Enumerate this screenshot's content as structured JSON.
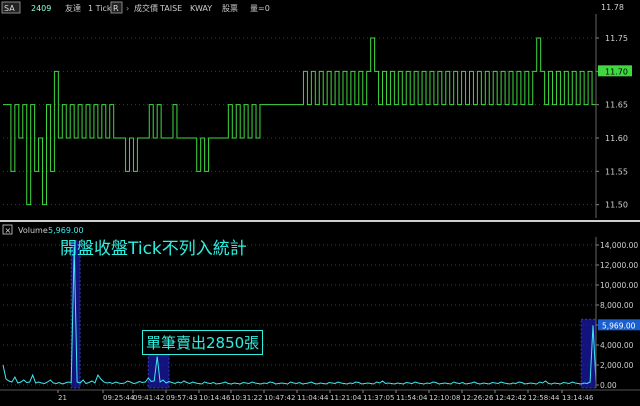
{
  "toolbar": {
    "sa_button": "SA",
    "symbol_code": "2409",
    "symbol_name": "友達",
    "interval": "1 Tick",
    "r_button": "R",
    "r_label": "成交價",
    "exchange": "TAISE",
    "source": "KWAY",
    "stock_label": "股票",
    "qty_label": "量=0"
  },
  "volume_panel": {
    "close_glyph": "×",
    "title": "Volume",
    "value": "5,969.00"
  },
  "annotations": {
    "open_close_note": "開盤收盤Tick不列入統計",
    "single_trade_note": "單筆賣出2850張"
  },
  "colors": {
    "background": "#000000",
    "price_line": "#3fd83f",
    "volume_line": "#40e8f0",
    "highlight_box": "#1a1aa8",
    "price_marker": "#3fd83f",
    "annotation_text": "#2ff0e0"
  },
  "chart_data": [
    {
      "type": "line",
      "title": "",
      "series": [
        {
          "name": "",
          "x": [
            0,
            2,
            4,
            6,
            8,
            10,
            12,
            14,
            16,
            18,
            20,
            22,
            24,
            26,
            28,
            30,
            32,
            34,
            36,
            38,
            40,
            42,
            44,
            46,
            48,
            50,
            52,
            54,
            56,
            58,
            60,
            62,
            64,
            66,
            68,
            70,
            72,
            74,
            76,
            78,
            80,
            82,
            84,
            86,
            88,
            90,
            92,
            94,
            96,
            98,
            100,
            102,
            104,
            106,
            108,
            110,
            112,
            114,
            116,
            118,
            120,
            122,
            124,
            126,
            128,
            130,
            132,
            134,
            136,
            138,
            140,
            142,
            144,
            146,
            148,
            150,
            152,
            154,
            156,
            158,
            160,
            162,
            164,
            166,
            168,
            170,
            172,
            174,
            176,
            178,
            180,
            182,
            184,
            186,
            188,
            190,
            192,
            194,
            196,
            198,
            200,
            202,
            204,
            206,
            208,
            210,
            212,
            214,
            216,
            218,
            220,
            222,
            224,
            226,
            228,
            230,
            232,
            234,
            236,
            238,
            240,
            242,
            244,
            246,
            248,
            250,
            252,
            254,
            256,
            258,
            260,
            262,
            264,
            266,
            268,
            270,
            272,
            274,
            276,
            278,
            280,
            282,
            284,
            286,
            288,
            290,
            292,
            294,
            296,
            298,
            300
          ],
          "values": [
            11.65,
            11.65,
            11.55,
            11.65,
            11.6,
            11.65,
            11.5,
            11.65,
            11.55,
            11.6,
            11.5,
            11.65,
            11.55,
            11.7,
            11.6,
            11.65,
            11.6,
            11.65,
            11.6,
            11.65,
            11.6,
            11.65,
            11.6,
            11.65,
            11.6,
            11.65,
            11.6,
            11.65,
            11.6,
            11.6,
            11.6,
            11.55,
            11.6,
            11.55,
            11.6,
            11.6,
            11.6,
            11.65,
            11.6,
            11.65,
            11.6,
            11.6,
            11.6,
            11.65,
            11.6,
            11.6,
            11.6,
            11.6,
            11.6,
            11.55,
            11.6,
            11.55,
            11.6,
            11.6,
            11.6,
            11.6,
            11.6,
            11.65,
            11.6,
            11.65,
            11.6,
            11.65,
            11.6,
            11.65,
            11.6,
            11.65,
            11.65,
            11.65,
            11.65,
            11.65,
            11.65,
            11.65,
            11.65,
            11.65,
            11.65,
            11.65,
            11.7,
            11.65,
            11.7,
            11.65,
            11.7,
            11.65,
            11.7,
            11.65,
            11.7,
            11.65,
            11.7,
            11.65,
            11.7,
            11.65,
            11.7,
            11.65,
            11.7,
            11.75,
            11.7,
            11.65,
            11.7,
            11.65,
            11.7,
            11.65,
            11.7,
            11.65,
            11.7,
            11.65,
            11.7,
            11.65,
            11.7,
            11.65,
            11.7,
            11.65,
            11.7,
            11.65,
            11.7,
            11.65,
            11.7,
            11.65,
            11.7,
            11.65,
            11.7,
            11.65,
            11.7,
            11.65,
            11.7,
            11.65,
            11.7,
            11.65,
            11.7,
            11.65,
            11.7,
            11.65,
            11.7,
            11.65,
            11.7,
            11.65,
            11.7,
            11.75,
            11.7,
            11.65,
            11.7,
            11.65,
            11.7,
            11.65,
            11.7,
            11.65,
            11.7,
            11.65,
            11.7,
            11.65,
            11.7,
            11.65,
            11.7
          ]
        }
      ],
      "ylim": [
        11.48,
        11.78
      ],
      "y_ticks": [
        "11.50",
        "11.55",
        "11.60",
        "11.65",
        "11.70",
        "11.75"
      ],
      "y_ticks_values": [
        11.5,
        11.55,
        11.6,
        11.65,
        11.7,
        11.75
      ],
      "last_value_label": "11.70",
      "last_value": 11.7,
      "top_value_label": "11.78"
    },
    {
      "type": "bar",
      "title": "Volume",
      "x": [
        0,
        1,
        2,
        3,
        4,
        5,
        6,
        7,
        8,
        9,
        10,
        11,
        12,
        13,
        14,
        15,
        16,
        17,
        18,
        19,
        20,
        21,
        22,
        23,
        24,
        25,
        26,
        27,
        28,
        29,
        30,
        31,
        32,
        33,
        34,
        35,
        36,
        37,
        38,
        39,
        40,
        41,
        42,
        43,
        44,
        45,
        46,
        47,
        48,
        49,
        50,
        51,
        52,
        53,
        54,
        55,
        56,
        57,
        58,
        59,
        60,
        61,
        62,
        63,
        64,
        65,
        66,
        67,
        68,
        69,
        70,
        71,
        72,
        73,
        74,
        75,
        76,
        77,
        78,
        79,
        80,
        81,
        82,
        83,
        84,
        85,
        86,
        87,
        88,
        89,
        90,
        91,
        92,
        93,
        94,
        95,
        96,
        97,
        98,
        99,
        100,
        101,
        102,
        103,
        104,
        105,
        106,
        107,
        108,
        109,
        110,
        111,
        112,
        113,
        114,
        115,
        116,
        117,
        118,
        119,
        120,
        121,
        122,
        123,
        124,
        125,
        126,
        127,
        128,
        129,
        130,
        131,
        132,
        133,
        134,
        135,
        136,
        137,
        138,
        139,
        140,
        141,
        142,
        143,
        144,
        145,
        146,
        147,
        148,
        149,
        150,
        151,
        152,
        153,
        154,
        155,
        156,
        157,
        158,
        159,
        160,
        161,
        162,
        163,
        164,
        165,
        166,
        167,
        168,
        169,
        170,
        171,
        172,
        173,
        174,
        175,
        176,
        177,
        178,
        179,
        180,
        181,
        182,
        183,
        184,
        185,
        186,
        187,
        188,
        189,
        190,
        191,
        192,
        193,
        194,
        195,
        196,
        197,
        198,
        199,
        200
      ],
      "values": [
        2000,
        600,
        400,
        300,
        800,
        200,
        300,
        500,
        250,
        300,
        1000,
        200,
        300,
        200,
        150,
        300,
        500,
        200,
        150,
        250,
        100,
        200,
        300,
        250,
        13800,
        300,
        200,
        500,
        150,
        250,
        400,
        200,
        1000,
        600,
        300,
        200,
        250,
        150,
        300,
        200,
        150,
        200,
        400,
        300,
        150,
        200,
        350,
        250,
        300,
        700,
        350,
        400,
        2850,
        300,
        500,
        200,
        350,
        250,
        150,
        300,
        200,
        400,
        250,
        150,
        300,
        200,
        150,
        100,
        300,
        200,
        150,
        250,
        100,
        150,
        200,
        300,
        150,
        100,
        200,
        150,
        100,
        250,
        200,
        150,
        300,
        200,
        150,
        100,
        200,
        150,
        300,
        250,
        100,
        150,
        200,
        150,
        100,
        300,
        200,
        150,
        250,
        100,
        150,
        200,
        300,
        150,
        100,
        200,
        150,
        100,
        250,
        200,
        150,
        300,
        200,
        150,
        100,
        200,
        150,
        300,
        250,
        100,
        150,
        200,
        150,
        100,
        300,
        200,
        400,
        150,
        200,
        150,
        100,
        200,
        150,
        100,
        250,
        200,
        150,
        300,
        200,
        150,
        100,
        200,
        150,
        300,
        250,
        100,
        150,
        200,
        150,
        100,
        300,
        200,
        150,
        250,
        100,
        150,
        200,
        300,
        150,
        100,
        200,
        150,
        100,
        250,
        200,
        150,
        300,
        200,
        150,
        100,
        200,
        150,
        300,
        250,
        100,
        150,
        200,
        150,
        100,
        300,
        200,
        400,
        150,
        100,
        200,
        150,
        100,
        250,
        200,
        150,
        300,
        200,
        150,
        100,
        200,
        150,
        300,
        5969,
        300,
        200,
        100
      ],
      "ylim": [
        -300,
        14800
      ],
      "y_ticks": [
        "0.00",
        "2,000.00",
        "4,000.00",
        "6,000.00",
        "8,000.00",
        "10,000.00",
        "12,000.00",
        "14,000.00"
      ],
      "y_ticks_values": [
        0,
        2000,
        4000,
        6000,
        8000,
        10000,
        12000,
        14000
      ],
      "last_value_label": "5,969.00",
      "last_value": 5969,
      "x_ticks": [
        "21",
        "09:25:44",
        "09:41:42",
        "09:57:43",
        "10:14:46",
        "10:31:22",
        "10:47:42",
        "11:04:44",
        "11:21:04",
        "11:37:05",
        "11:54:04",
        "12:10:08",
        "12:26:26",
        "12:42:42",
        "12:58:44",
        "13:14:46"
      ],
      "highlight_ranges": [
        [
          23,
          26
        ],
        [
          49,
          56
        ],
        [
          195,
          200
        ]
      ]
    }
  ]
}
